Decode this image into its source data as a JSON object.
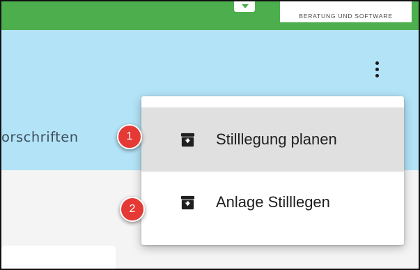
{
  "header": {
    "logo_tagline": "BERATUNG UND SOFTWARE",
    "logo_icon": "download-box-icon"
  },
  "appbar": {
    "partial_title": "orschriften",
    "menu_icon": "more-vert-icon"
  },
  "menu": {
    "items": [
      {
        "label": "Stilllegung planen",
        "icon": "archive-box-icon",
        "highlighted": true
      },
      {
        "label": "Anlage Stilllegen",
        "icon": "archive-box-icon",
        "highlighted": false
      }
    ]
  },
  "annotations": {
    "badges": [
      "1",
      "2"
    ],
    "color": "#e53935"
  },
  "colors": {
    "topbar": "#4cae4c",
    "appbar": "#b3e3f7",
    "menu_hover": "#e0e0e0"
  }
}
